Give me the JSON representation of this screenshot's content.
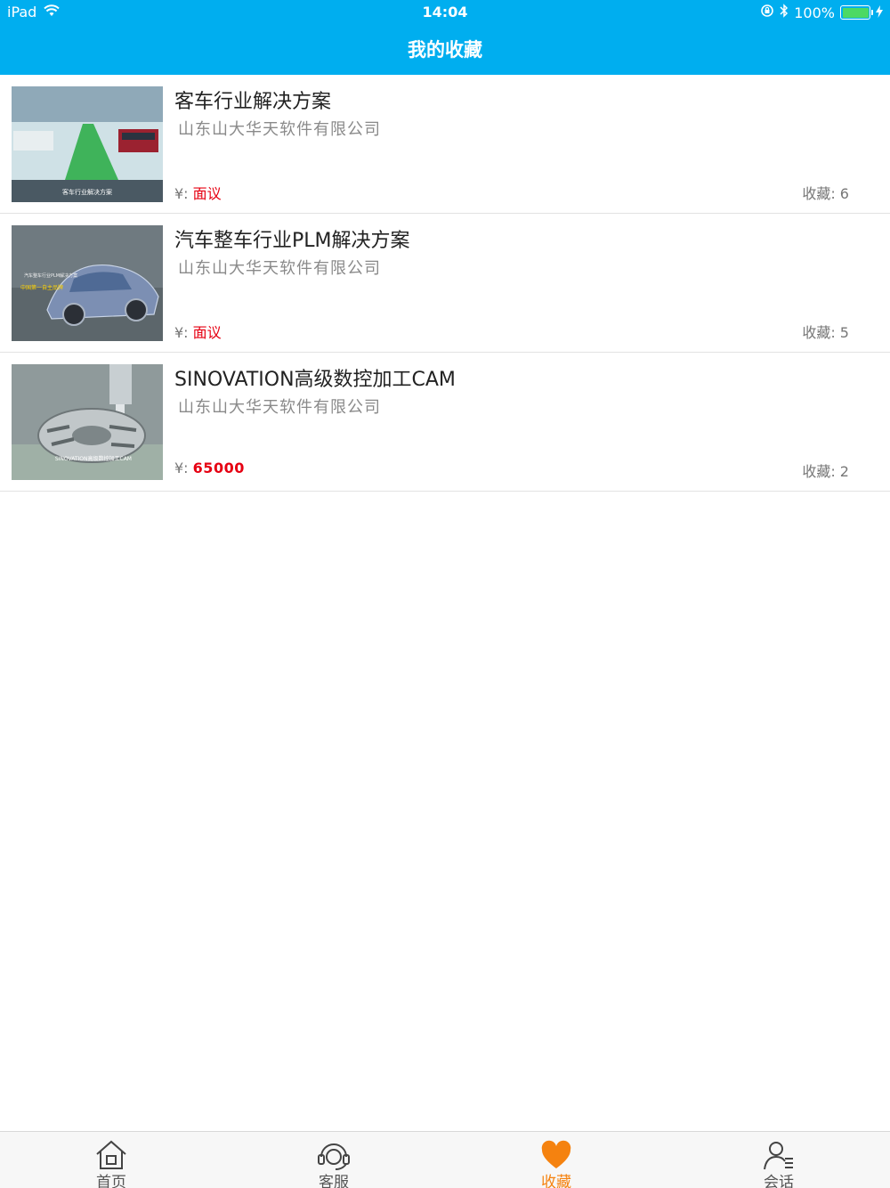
{
  "status_bar": {
    "device": "iPad",
    "time": "14:04",
    "battery": "100%"
  },
  "header": {
    "title": "我的收藏"
  },
  "favorites": [
    {
      "title": "客车行业解决方案",
      "company": "山东山大华天软件有限公司",
      "price_prefix": "¥:",
      "price": "面议",
      "fav_label": "收藏: 6",
      "thumb_caption": "客车行业解决方案"
    },
    {
      "title": "汽车整车行业PLM解决方案",
      "company": "山东山大华天软件有限公司",
      "price_prefix": "¥:",
      "price": "面议",
      "fav_label": "收藏: 5",
      "thumb_caption": "汽车整车行业PLM解决方案",
      "thumb_subcaption": "中国第一自主品牌"
    },
    {
      "title": "SINOVATION高级数控加工CAM",
      "company": "山东山大华天软件有限公司",
      "price_prefix": "¥:",
      "price": "65000",
      "fav_label": "收藏: 2",
      "thumb_caption": "SINOVATION高级数控加工CAM"
    }
  ],
  "tabbar": {
    "items": [
      {
        "label": "首页",
        "icon": "home-icon"
      },
      {
        "label": "客服",
        "icon": "headset-icon"
      },
      {
        "label": "收藏",
        "icon": "heart-icon",
        "active": true
      },
      {
        "label": "会话",
        "icon": "user-chat-icon"
      }
    ]
  },
  "colors": {
    "header": "#00aeef",
    "price": "#e60012",
    "active_tab": "#f5820f"
  }
}
